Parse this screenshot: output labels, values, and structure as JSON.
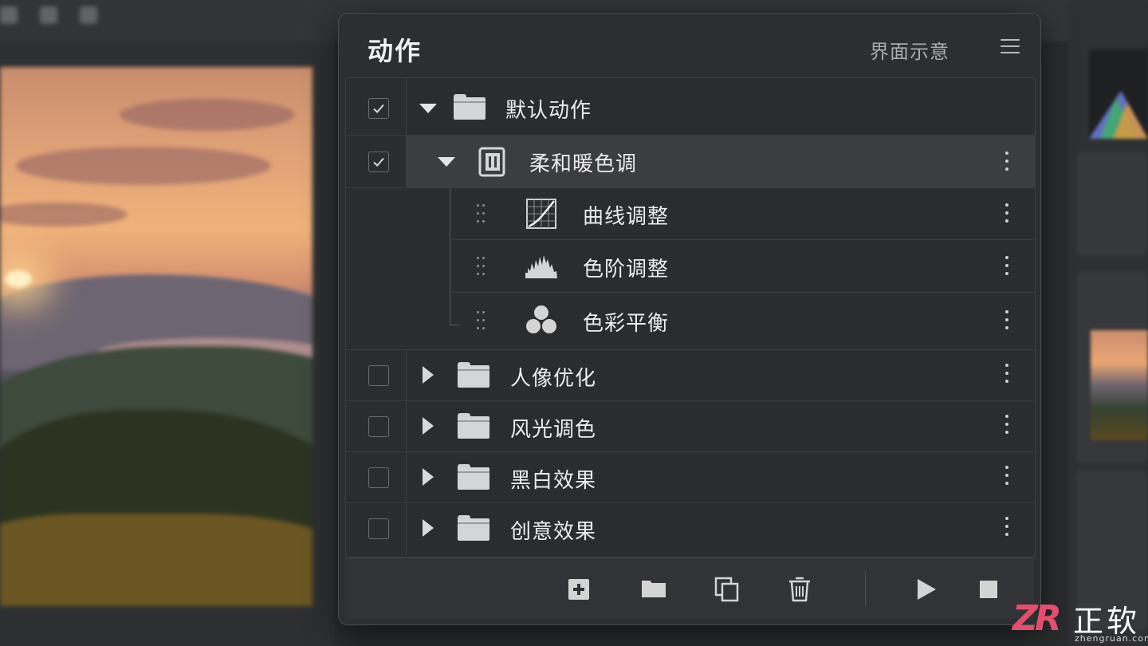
{
  "panel": {
    "title": "动作",
    "note": "界面示意",
    "menu_icon": "hamburger-menu-icon"
  },
  "action_sets": [
    {
      "label": "默认动作",
      "checked": true,
      "expanded": true,
      "icon": "folder-icon",
      "actions": [
        {
          "label": "柔和暖色调",
          "checked": true,
          "expanded": true,
          "selected": true,
          "icon": "action-icon",
          "steps": [
            {
              "label": "曲线调整",
              "icon": "curves-icon"
            },
            {
              "label": "色阶调整",
              "icon": "levels-icon"
            },
            {
              "label": "色彩平衡",
              "icon": "color-balance-icon"
            }
          ]
        }
      ]
    },
    {
      "label": "人像优化",
      "checked": false,
      "expanded": false,
      "icon": "folder-icon"
    },
    {
      "label": "风光调色",
      "checked": false,
      "expanded": false,
      "icon": "folder-icon"
    },
    {
      "label": "黑白效果",
      "checked": false,
      "expanded": false,
      "icon": "folder-icon"
    },
    {
      "label": "创意效果",
      "checked": false,
      "expanded": false,
      "icon": "folder-icon"
    }
  ],
  "footer_buttons": [
    {
      "name": "new-action",
      "icon": "add-square-icon"
    },
    {
      "name": "new-set",
      "icon": "folder-icon"
    },
    {
      "name": "duplicate",
      "icon": "duplicate-icon"
    },
    {
      "name": "delete",
      "icon": "trash-icon"
    },
    {
      "name": "play",
      "icon": "play-icon"
    },
    {
      "name": "stop",
      "icon": "stop-icon"
    }
  ],
  "watermark": {
    "logo": "ZR",
    "brand": "正软",
    "url": "zhengruan.com"
  },
  "colors": {
    "panel_bg": "#2d2e30",
    "selected_row": "#3c3d40",
    "watermark_accent": "#e0506e"
  }
}
